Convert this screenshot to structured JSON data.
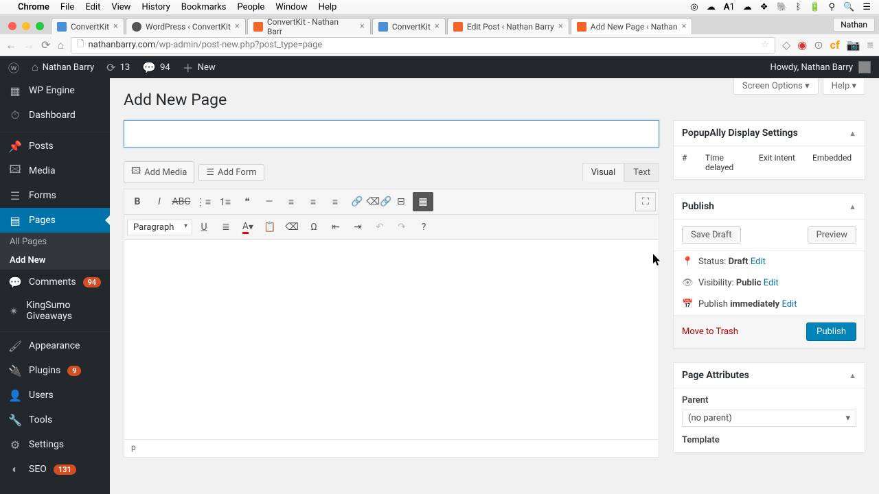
{
  "mac_menu": {
    "app": "Chrome",
    "items": [
      "File",
      "Edit",
      "View",
      "History",
      "Bookmarks",
      "People",
      "Window",
      "Help"
    ]
  },
  "chrome": {
    "profile": "Nathan",
    "url_host": "nathanbarry.com",
    "url_path": "/wp-admin/post-new.php?post_type=page",
    "tabs": [
      {
        "label": "ConvertKit",
        "icon": "blue"
      },
      {
        "label": "WordPress ‹ ConvertKit",
        "icon": "wp"
      },
      {
        "label": "ConvertKit - Nathan Barr",
        "icon": "orange"
      },
      {
        "label": "ConvertKit",
        "icon": "blue"
      },
      {
        "label": "Edit Post ‹ Nathan Barry",
        "icon": "orange"
      },
      {
        "label": "Add New Page ‹ Nathan",
        "icon": "orange",
        "active": true
      }
    ]
  },
  "adminbar": {
    "site": "Nathan Barry",
    "updates": "13",
    "comments": "94",
    "new": "New",
    "howdy": "Howdy, Nathan Barry"
  },
  "sidebar": {
    "items": [
      {
        "label": "WP Engine",
        "icon": "⚙"
      },
      {
        "label": "Dashboard",
        "icon": "⌂"
      },
      {
        "label": "Posts",
        "icon": "📌"
      },
      {
        "label": "Media",
        "icon": "🖾"
      },
      {
        "label": "Forms",
        "icon": "☰"
      },
      {
        "label": "Pages",
        "icon": "▤",
        "current": true
      },
      {
        "label": "Comments",
        "icon": "💬",
        "badge": "94"
      },
      {
        "label": "KingSumo Giveaways",
        "icon": "✴"
      },
      {
        "label": "Appearance",
        "icon": "✎"
      },
      {
        "label": "Plugins",
        "icon": "⚡",
        "badge": "9"
      },
      {
        "label": "Users",
        "icon": "👤"
      },
      {
        "label": "Tools",
        "icon": "🔧"
      },
      {
        "label": "Settings",
        "icon": "⚙"
      },
      {
        "label": "SEO",
        "icon": "◐",
        "badge": "131"
      }
    ],
    "submenu": [
      {
        "label": "All Pages"
      },
      {
        "label": "Add New",
        "current": true
      }
    ]
  },
  "screen_meta": {
    "screen_options": "Screen Options",
    "help": "Help"
  },
  "page": {
    "title": "Add New Page",
    "title_value": ""
  },
  "media": {
    "add_media": "Add Media",
    "add_form": "Add Form"
  },
  "editor": {
    "visual": "Visual",
    "text": "Text",
    "format": "Paragraph",
    "status_path": "p"
  },
  "popupally": {
    "title": "PopupAlly Display Settings",
    "headers": [
      "#",
      "Time delayed",
      "Exit intent",
      "Embedded"
    ]
  },
  "publish": {
    "title": "Publish",
    "save_draft": "Save Draft",
    "preview": "Preview",
    "status_label": "Status:",
    "status_value": "Draft",
    "status_edit": "Edit",
    "visibility_label": "Visibility:",
    "visibility_value": "Public",
    "visibility_edit": "Edit",
    "schedule_label": "Publish",
    "schedule_value": "immediately",
    "schedule_edit": "Edit",
    "trash": "Move to Trash",
    "publish_btn": "Publish"
  },
  "page_attrs": {
    "title": "Page Attributes",
    "parent_label": "Parent",
    "parent_value": "(no parent)",
    "template_label": "Template"
  }
}
